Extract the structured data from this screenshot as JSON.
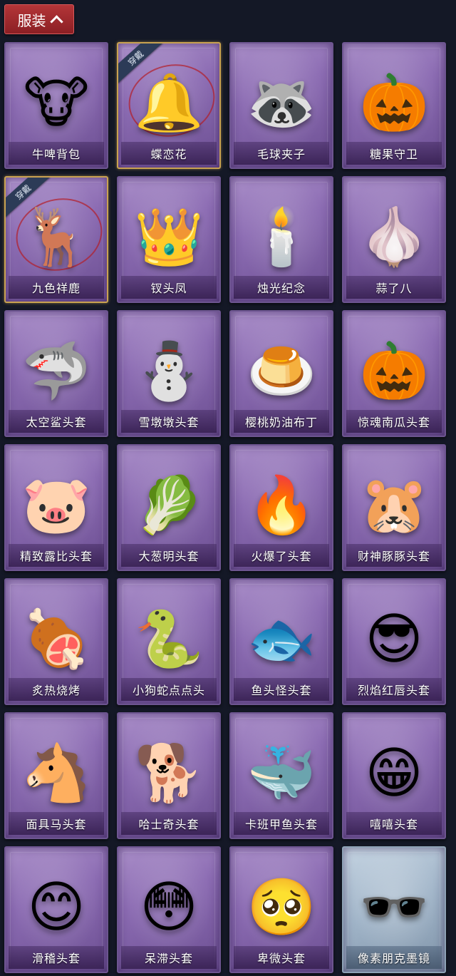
{
  "header": {
    "title": "服装"
  },
  "items": [
    {
      "name": "牛啤背包",
      "icon": "🐮",
      "worn": false,
      "theme": "purple"
    },
    {
      "name": "蝶恋花",
      "icon": "🔔",
      "worn": true,
      "theme": "purple"
    },
    {
      "name": "毛球夹子",
      "icon": "🦝",
      "worn": false,
      "theme": "purple"
    },
    {
      "name": "糖果守卫",
      "icon": "🎃",
      "worn": false,
      "theme": "purple"
    },
    {
      "name": "九色祥鹿",
      "icon": "🦌",
      "worn": true,
      "theme": "purple"
    },
    {
      "name": "钗头凤",
      "icon": "👑",
      "worn": false,
      "theme": "purple"
    },
    {
      "name": "烛光纪念",
      "icon": "🕯️",
      "worn": false,
      "theme": "purple"
    },
    {
      "name": "蒜了八",
      "icon": "🧄",
      "worn": false,
      "theme": "purple"
    },
    {
      "name": "太空鲨头套",
      "icon": "🦈",
      "worn": false,
      "theme": "purple"
    },
    {
      "name": "雪墩墩头套",
      "icon": "⛄",
      "worn": false,
      "theme": "purple"
    },
    {
      "name": "樱桃奶油布丁",
      "icon": "🍮",
      "worn": false,
      "theme": "purple"
    },
    {
      "name": "惊魂南瓜头套",
      "icon": "🎃",
      "worn": false,
      "theme": "purple"
    },
    {
      "name": "精致露比头套",
      "icon": "🐷",
      "worn": false,
      "theme": "purple"
    },
    {
      "name": "大葱明头套",
      "icon": "🥬",
      "worn": false,
      "theme": "purple"
    },
    {
      "name": "火爆了头套",
      "icon": "🔥",
      "worn": false,
      "theme": "purple"
    },
    {
      "name": "财神豚豚头套",
      "icon": "🐹",
      "worn": false,
      "theme": "purple"
    },
    {
      "name": "炙热烧烤",
      "icon": "🍖",
      "worn": false,
      "theme": "purple"
    },
    {
      "name": "小狗蛇点点头",
      "icon": "🐍",
      "worn": false,
      "theme": "purple"
    },
    {
      "name": "鱼头怪头套",
      "icon": "🐟",
      "worn": false,
      "theme": "purple"
    },
    {
      "name": "烈焰红唇头套",
      "icon": "😎",
      "worn": false,
      "theme": "purple"
    },
    {
      "name": "面具马头套",
      "icon": "🐴",
      "worn": false,
      "theme": "purple"
    },
    {
      "name": "哈士奇头套",
      "icon": "🐕",
      "worn": false,
      "theme": "purple"
    },
    {
      "name": "卡班甲鱼头套",
      "icon": "🐳",
      "worn": false,
      "theme": "purple"
    },
    {
      "name": "嘻嘻头套",
      "icon": "😁",
      "worn": false,
      "theme": "purple"
    },
    {
      "name": "滑稽头套",
      "icon": "😊",
      "worn": false,
      "theme": "purple"
    },
    {
      "name": "呆滞头套",
      "icon": "😳",
      "worn": false,
      "theme": "purple"
    },
    {
      "name": "卑微头套",
      "icon": "🥺",
      "worn": false,
      "theme": "purple"
    },
    {
      "name": "像素朋克墨镜",
      "icon": "🕶️",
      "worn": false,
      "theme": "pale"
    }
  ],
  "worn_label": "穿戴",
  "colors": {
    "header_red": "#a82a2e",
    "card_purple": "#8c6cb3",
    "worn_gold": "#c9a251",
    "background": "#141826"
  }
}
